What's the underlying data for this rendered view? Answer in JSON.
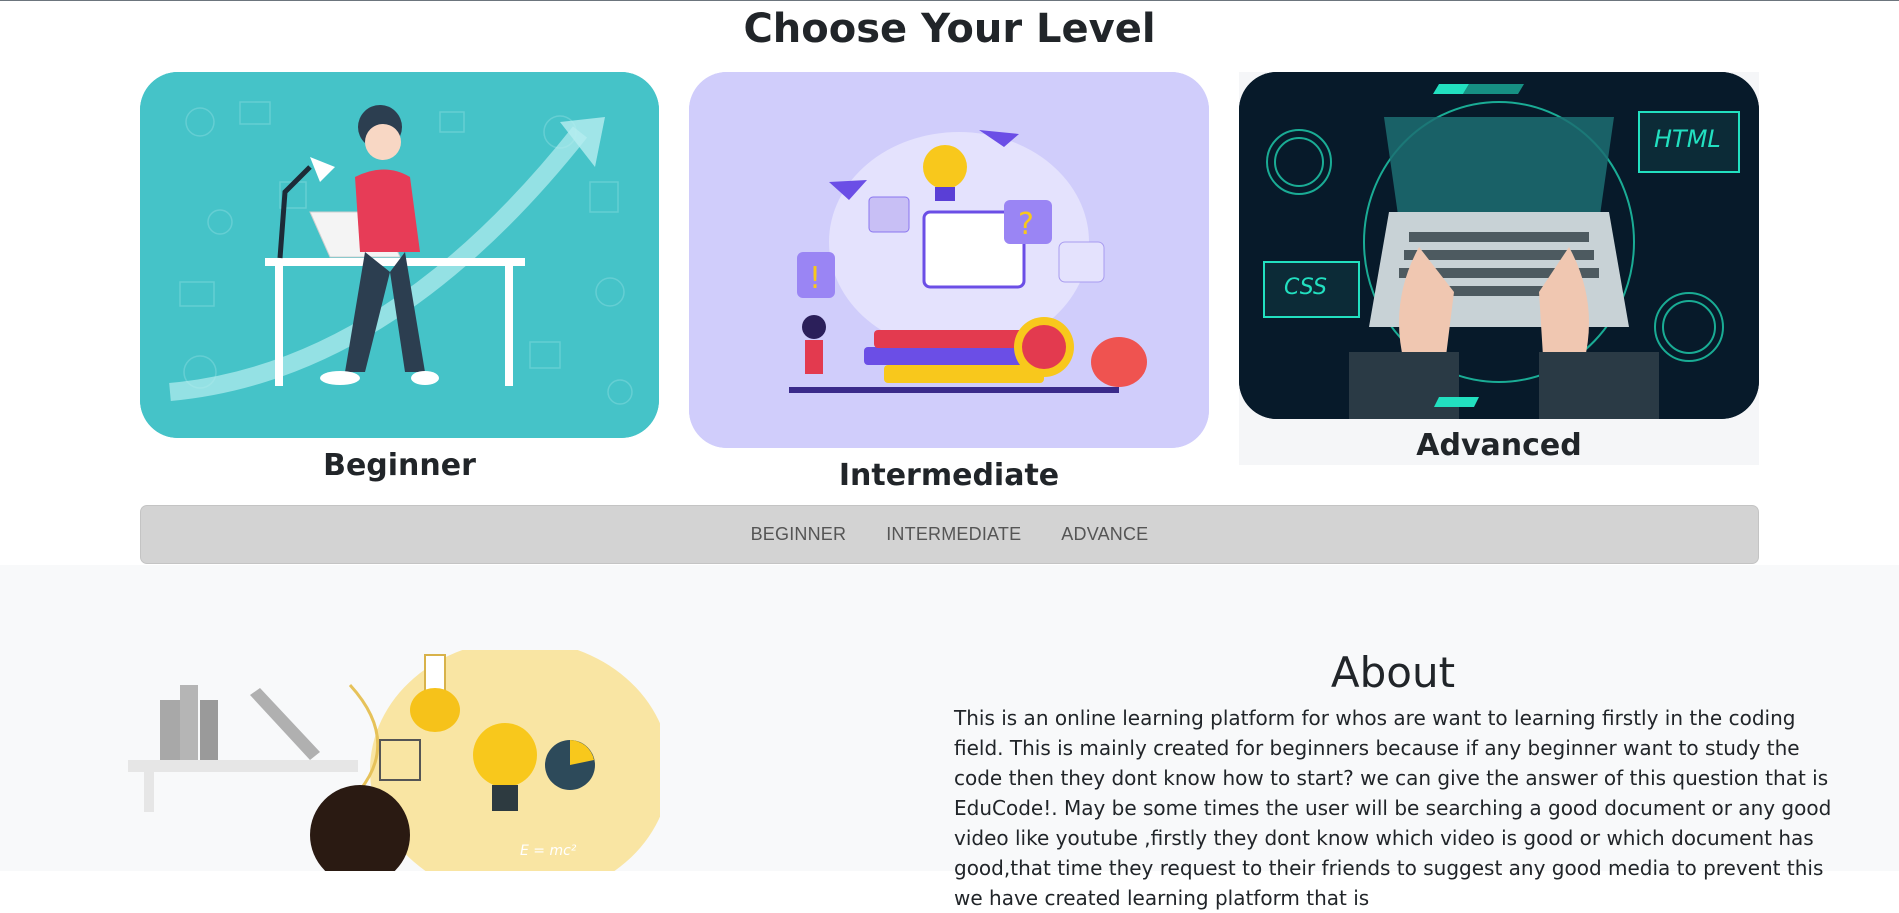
{
  "header": {
    "title": "Choose Your Level"
  },
  "levels": [
    {
      "label": "Beginner",
      "image_icon": "person-at-laptop-growth-illustration",
      "accent": "#45c3c8"
    },
    {
      "label": "Intermediate",
      "image_icon": "students-learning-books-illustration",
      "accent": "#d0cdfb"
    },
    {
      "label": "Advanced",
      "image_icon": "hands-typing-laptop-html-css-illustration",
      "accent": "#071a2a"
    }
  ],
  "nav": {
    "items": [
      "BEGINNER",
      "INTERMEDIATE",
      "ADVANCE"
    ]
  },
  "about": {
    "title": "About",
    "text": "This is an online learning platform for whos are want to learning firstly in the coding field. This is mainly created for beginners because if any beginner want to study the code then they dont know how to start? we can give the answer of this question that is EduCode!. May be some times the user will be searching a good document or any good video like youtube ,firstly they dont know which video is good or which document has good,that time they request to their friends to suggest any good media to prevent this we have created learning platform that is",
    "image_icon": "science-learning-illustration"
  },
  "colors": {
    "nav_bg": "#d3d3d3",
    "section_bg": "#f8f9fa",
    "text": "#212529"
  }
}
